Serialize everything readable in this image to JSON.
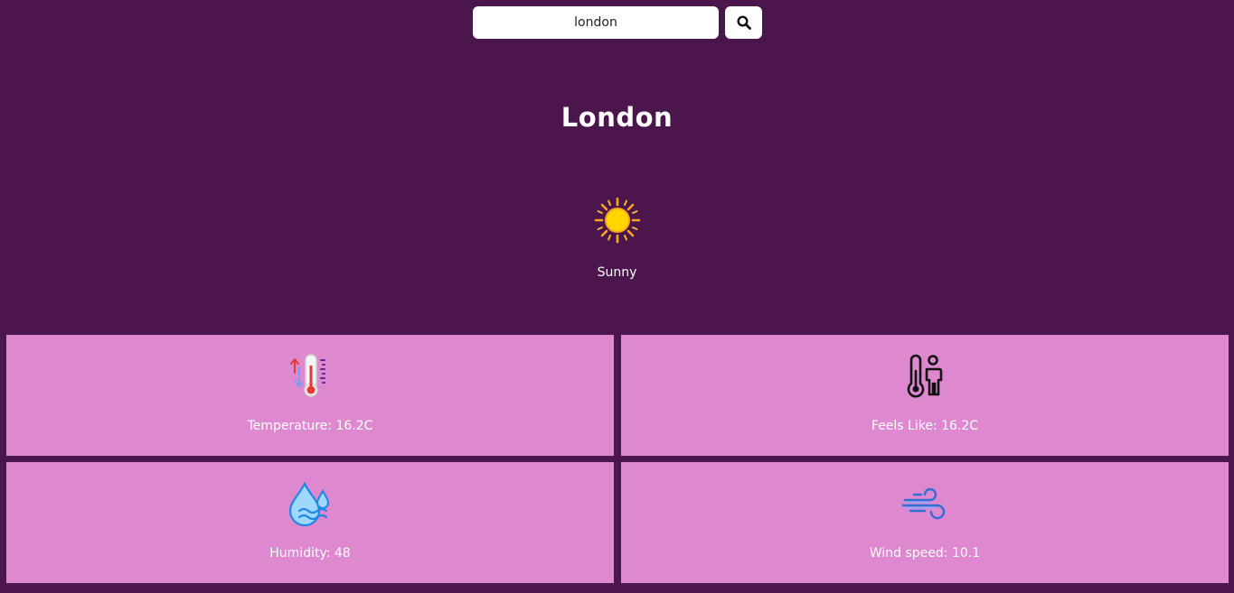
{
  "search": {
    "value": "london",
    "placeholder": ""
  },
  "location": {
    "city": "London"
  },
  "condition": {
    "text": "Sunny",
    "icon": "sun-icon"
  },
  "stats": [
    {
      "label": "Temperature: 16.2C",
      "icon": "thermometer-icon"
    },
    {
      "label": "Feels Like: 16.2C",
      "icon": "feels-like-icon"
    },
    {
      "label": "Humidity: 48",
      "icon": "humidity-icon"
    },
    {
      "label": "Wind speed: 10.1",
      "icon": "wind-icon"
    }
  ],
  "colors": {
    "background": "#4a164c",
    "card": "#dd88cf",
    "text": "#ffffff"
  }
}
